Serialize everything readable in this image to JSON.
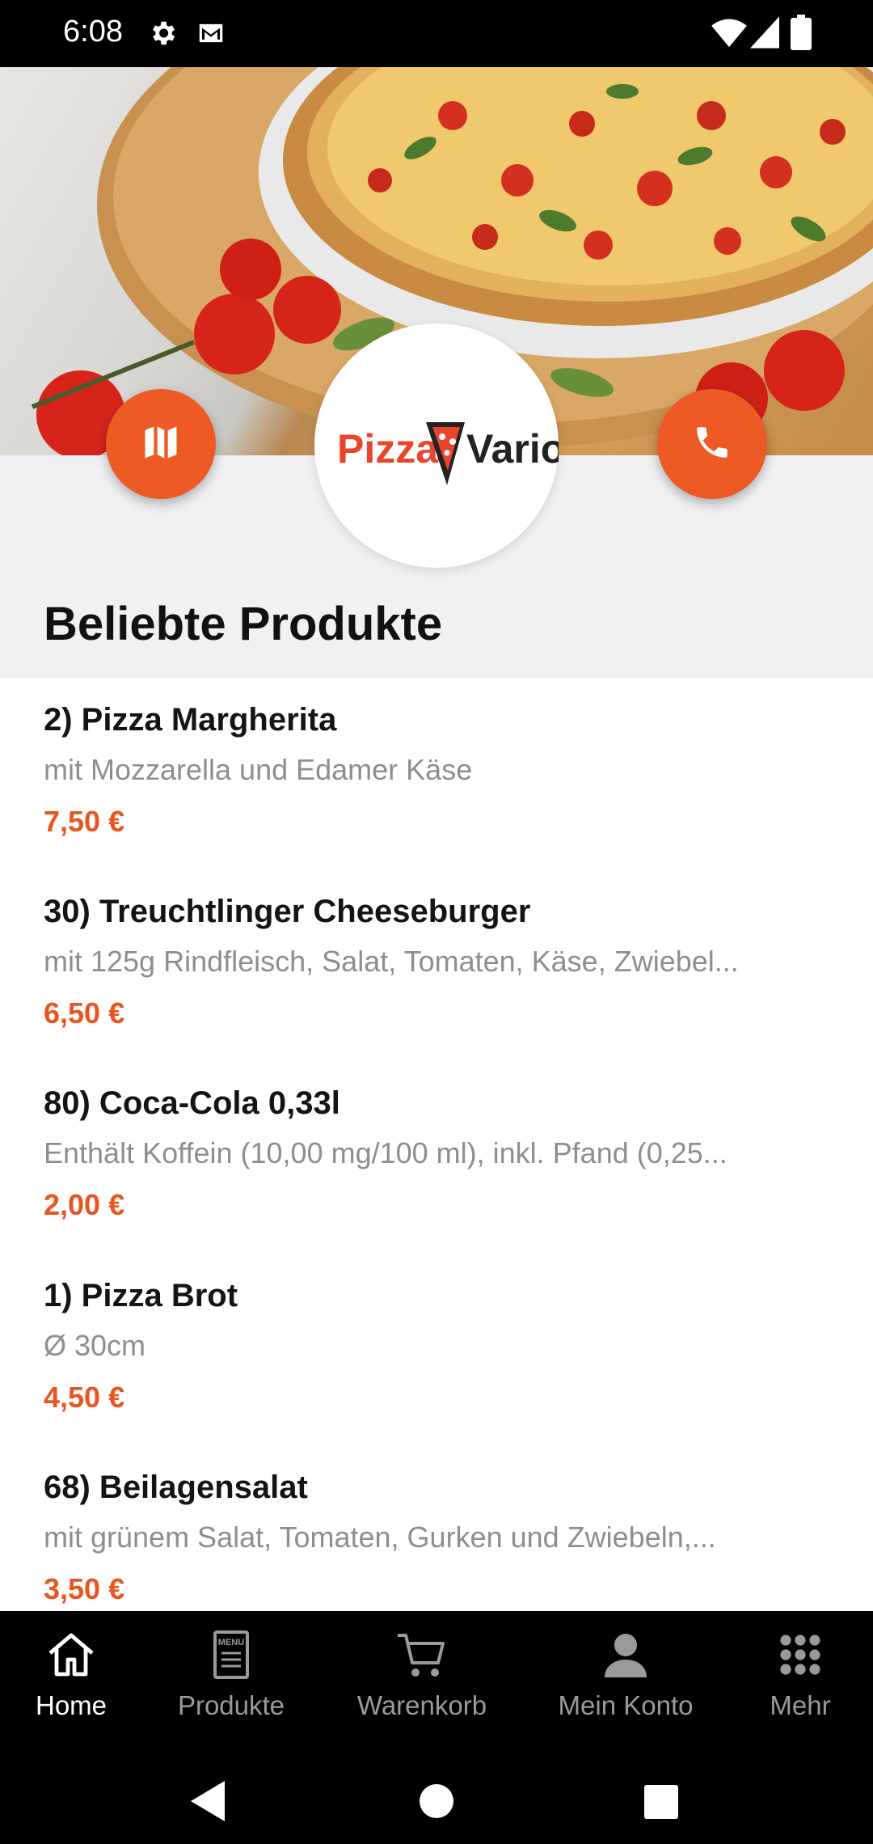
{
  "status_bar": {
    "time": "6:08"
  },
  "hero": {
    "logo_text_left": "Pizza",
    "logo_text_right": "Vario"
  },
  "section": {
    "title": "Beliebte Produkte"
  },
  "products": [
    {
      "name": "2) Pizza Margherita",
      "desc": "mit Mozzarella und Edamer Käse",
      "price": "7,50 €"
    },
    {
      "name": "30) Treuchtlinger Cheeseburger",
      "desc": "mit 125g Rindfleisch, Salat, Tomaten, Käse, Zwiebel...",
      "price": "6,50 €"
    },
    {
      "name": "80) Coca-Cola 0,33l",
      "desc": "Enthält Koffein (10,00 mg/100 ml), inkl. Pfand (0,25...",
      "price": "2,00 €"
    },
    {
      "name": "1) Pizza Brot",
      "desc": "Ø 30cm",
      "price": "4,50 €"
    },
    {
      "name": "68) Beilagensalat",
      "desc": "mit grünem Salat, Tomaten, Gurken und Zwiebeln,...",
      "price": "3,50 €"
    }
  ],
  "bottom_nav": {
    "items": [
      {
        "label": "Home",
        "icon": "home-icon",
        "active": true
      },
      {
        "label": "Produkte",
        "icon": "menu-card-icon",
        "menu_text": "MENU"
      },
      {
        "label": "Warenkorb",
        "icon": "cart-icon"
      },
      {
        "label": "Mein Konto",
        "icon": "user-icon"
      },
      {
        "label": "Mehr",
        "icon": "grid-icon"
      }
    ]
  },
  "colors": {
    "accent": "#ee5a24",
    "price": "#e8561f",
    "section_bg": "#f1f1f4"
  }
}
